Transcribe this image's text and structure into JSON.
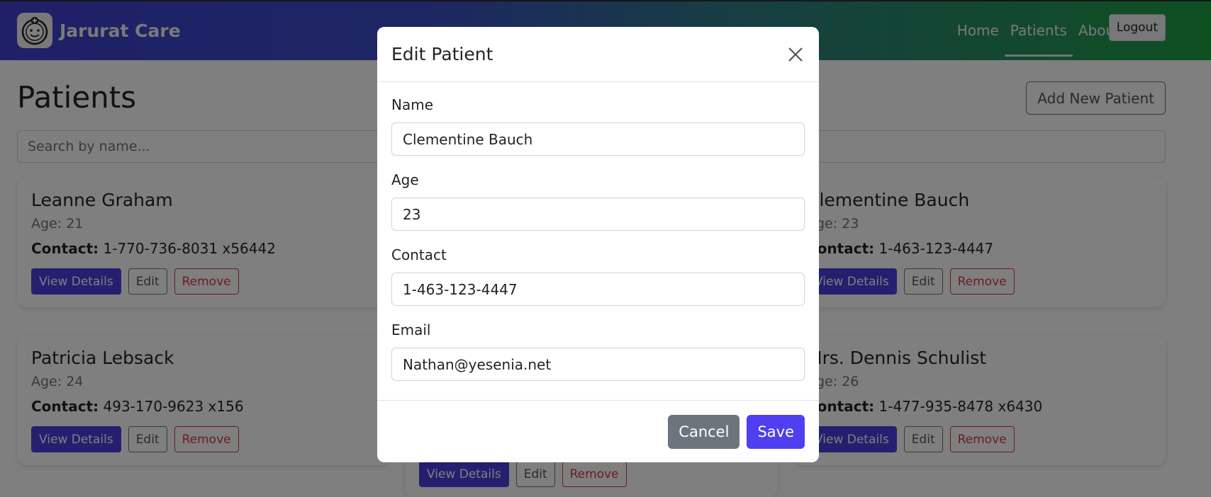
{
  "navbar": {
    "brand": "Jarurat Care",
    "links": [
      {
        "label": "Home"
      },
      {
        "label": "Patients"
      },
      {
        "label": "About"
      }
    ],
    "logout_label": "Logout"
  },
  "page": {
    "title": "Patients",
    "add_button_label": "Add New Patient",
    "search_placeholder": "Search by name..."
  },
  "cards": [
    {
      "name": "Leanne Graham",
      "age": "Age: 21",
      "contact_label": "Contact:",
      "contact": "1-770-736-8031 x56442"
    },
    {
      "name": "Clementine Bauch",
      "age": "Age: 23",
      "contact_label": "Contact:",
      "contact": "1-463-123-4447"
    },
    {
      "name": "Patricia Lebsack",
      "age": "Age: 24",
      "contact_label": "Contact:",
      "contact": "493-170-9623 x156"
    },
    {
      "name": "Mrs. Dennis Schulist",
      "age": "Age: 26",
      "contact_label": "Contact:",
      "contact": "1-477-935-8478 x6430"
    }
  ],
  "card_buttons": {
    "view": "View Details",
    "edit": "Edit",
    "remove": "Remove"
  },
  "modal": {
    "title": "Edit Patient",
    "fields": {
      "name_label": "Name",
      "name_value": "Clementine Bauch",
      "age_label": "Age",
      "age_value": "23",
      "contact_label": "Contact",
      "contact_value": "1-463-123-4447",
      "email_label": "Email",
      "email_value": "Nathan@yesenia.net"
    },
    "cancel_label": "Cancel",
    "save_label": "Save"
  },
  "colors": {
    "primary": "#4b3fe0",
    "danger": "#dc3545",
    "secondary": "#6c757d",
    "nav_gradient_start": "#3f3fd1",
    "nav_gradient_end": "#1fa043"
  }
}
